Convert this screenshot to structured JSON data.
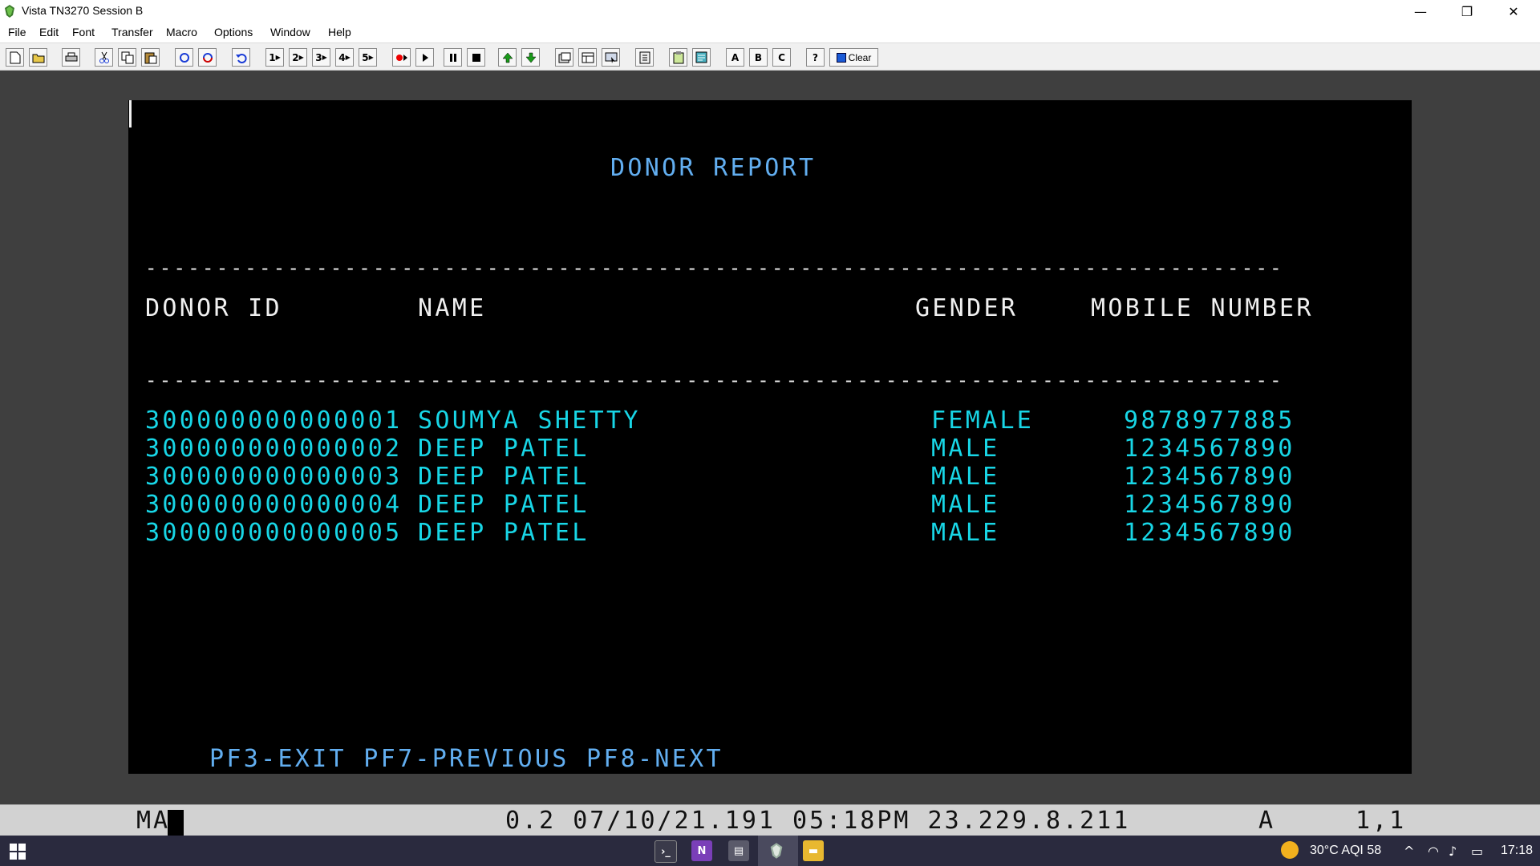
{
  "window": {
    "title": "Vista TN3270 Session B",
    "minimize": "—",
    "restore": "❐",
    "close": "✕"
  },
  "menu": [
    "File",
    "Edit",
    "Font",
    "Transfer",
    "Macro",
    "Options",
    "Window",
    "Help"
  ],
  "toolbar": {
    "macro1": "1",
    "macro2": "2",
    "macro3": "3",
    "macro4": "4",
    "macro5": "5",
    "a": "A",
    "b": "B",
    "c": "C",
    "help": "?",
    "clear": "Clear"
  },
  "screen": {
    "title": "DONOR REPORT",
    "separator": "--------------------------------------------------------------------------------",
    "headers": {
      "id": "DONOR ID",
      "name": "NAME",
      "gender": "GENDER",
      "mobile": "MOBILE NUMBER"
    },
    "rows": [
      {
        "id": "300000000000001",
        "name": "SOUMYA SHETTY",
        "gender": "FEMALE",
        "mobile": "9878977885"
      },
      {
        "id": "300000000000002",
        "name": "DEEP PATEL",
        "gender": "MALE",
        "mobile": "1234567890"
      },
      {
        "id": "300000000000003",
        "name": "DEEP PATEL",
        "gender": "MALE",
        "mobile": "1234567890"
      },
      {
        "id": "300000000000004",
        "name": "DEEP PATEL",
        "gender": "MALE",
        "mobile": "1234567890"
      },
      {
        "id": "300000000000005",
        "name": "DEEP PATEL",
        "gender": "MALE",
        "mobile": "1234567890"
      }
    ],
    "pf_keys": "PF3-EXIT PF7-PREVIOUS PF8-NEXT"
  },
  "status": {
    "mode": "MA",
    "info": "0.2 07/10/21.191 05:18PM 23.229.8.211",
    "field": "A",
    "position": "1,1"
  },
  "taskbar": {
    "weather": "30°C AQI 58",
    "time": "17:18"
  }
}
